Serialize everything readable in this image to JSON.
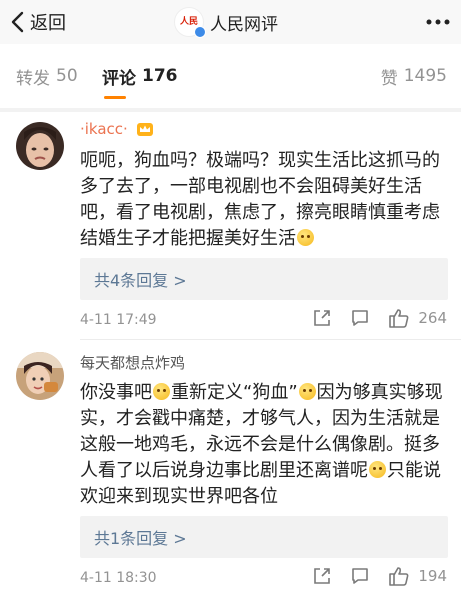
{
  "nav": {
    "back_label": "返回",
    "title": "人民网评",
    "avatar_text": "人民\n网评"
  },
  "tabs": {
    "repost": {
      "label": "转发",
      "count": "50"
    },
    "comments": {
      "label": "评论",
      "count": "176"
    },
    "likes": {
      "label": "赞",
      "count": "1495"
    }
  },
  "comments": [
    {
      "name": "·ikacc·",
      "text_parts": [
        "呃呃，狗血吗？极端吗？现实生活比这抓马的多了去了，一部电视剧也不会阻碍美好生活吧，看了电视剧，焦虑了，擦亮眼睛慎重考虑结婚生子才能把握美好生活",
        ""
      ],
      "replies": "共4条回复 >",
      "time": "4-11 17:49",
      "likes": "264"
    },
    {
      "name": "每天都想点炸鸡",
      "text_parts": [
        "你没事吧",
        "重新定义“狗血”",
        "因为够真实够现实，才会戳中痛楚，才够气人，因为生活就是这般一地鸡毛，永远不会是什么偶像剧。挺多人看了以后说身边事比剧里还离谱呢",
        "只能说欢迎来到现实世界吧各位"
      ],
      "replies": "共1条回复 >",
      "time": "4-11 18:30",
      "likes": "194"
    }
  ],
  "colors": {
    "accent": "#ff8200",
    "username_vip": "#eb7350",
    "reply_link": "#5d7895",
    "meta_gray": "#939393"
  }
}
